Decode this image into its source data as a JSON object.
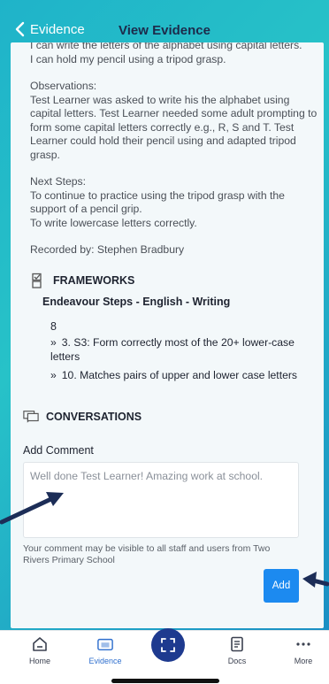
{
  "header": {
    "back_label": "Evidence",
    "title": "View Evidence"
  },
  "evidence": {
    "clipped_line": "I can write the letters of the alphabet using capital letters.",
    "line_grasp": "I can hold my pencil using a tripod grasp.",
    "observations_heading": "Observations:",
    "observations_text": "Test Learner was asked to write his the alphabet using capital letters. Test Learner needed some adult prompting to form some capital letters correctly e.g., R, S and T. Test Learner could hold their pencil using and adapted tripod grasp.",
    "next_steps_heading": "Next Steps:",
    "next_steps_1": "To continue to practice using the tripod grasp with the support of a pencil grip.",
    "next_steps_2": "To write lowercase letters correctly.",
    "recorded_by": "Recorded by: Stephen Bradbury"
  },
  "frameworks": {
    "heading": "FRAMEWORKS",
    "name": "Endeavour Steps - English - Writing",
    "level": "8",
    "items": [
      "3. S3: Form correctly most of the 20+ lower-case letters",
      "10. Matches pairs of upper and lower case letters"
    ],
    "chevron": "»"
  },
  "conversations": {
    "heading": "CONVERSATIONS",
    "add_comment_label": "Add Comment",
    "comment_placeholder": "Well done Test Learner! Amazing work at school.",
    "visibility_note": "Your comment may be visible to all staff and users from Two Rivers Primary School",
    "add_button": "Add"
  },
  "tabbar": {
    "items": [
      {
        "label": "Home",
        "icon": "home-icon"
      },
      {
        "label": "Evidence",
        "icon": "evidence-icon"
      },
      {
        "label": "Docs",
        "icon": "docs-icon"
      },
      {
        "label": "More",
        "icon": "more-icon"
      }
    ],
    "center_icon": "scan-icon"
  },
  "colors": {
    "accent": "#1c8af0",
    "active_tab": "#2f6fce",
    "scan_button": "#1e3a8f",
    "header_gradient_start": "#1fb3c9",
    "header_gradient_end": "#1a8fc4"
  }
}
